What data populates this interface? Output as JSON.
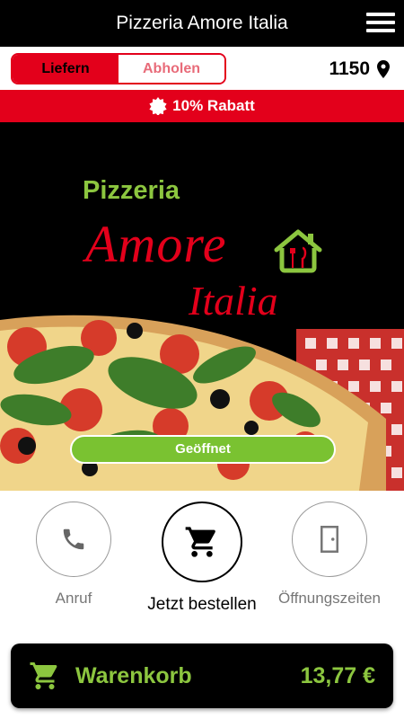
{
  "header": {
    "title": "Pizzeria Amore Italia",
    "menu_icon": "hamburger-menu-icon"
  },
  "order_mode": {
    "options": [
      "Liefern",
      "Abholen"
    ],
    "selected": "Liefern"
  },
  "location": {
    "zip": "1150",
    "icon": "map-pin-icon"
  },
  "discount": {
    "icon": "badge-icon",
    "label": "10% Rabatt"
  },
  "hero": {
    "logo_line1": "Pizzeria",
    "logo_line2": "Amore",
    "logo_line3": "Italia",
    "status": "Geöffnet"
  },
  "actions": [
    {
      "label": "Anruf",
      "icon": "phone-icon"
    },
    {
      "label": "Jetzt bestellen",
      "icon": "shopping-cart-icon"
    },
    {
      "label": "Öffnungszeiten",
      "icon": "door-icon"
    }
  ],
  "cart": {
    "label": "Warenkorb",
    "total": "13,77 €",
    "icon": "shopping-cart-icon"
  },
  "colors": {
    "brand_red": "#e3001b",
    "brand_green": "#8cc63f",
    "status_green": "#7ac231"
  }
}
